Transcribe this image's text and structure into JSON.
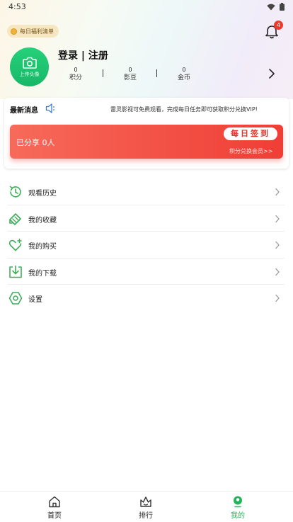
{
  "status_bar": {
    "time": "4:53"
  },
  "header": {
    "welfare_label": "每日福利清单",
    "notification_count": "4"
  },
  "profile": {
    "avatar_label": "上传头像",
    "login_label": "登录 | 注册",
    "stats": [
      {
        "value": "0",
        "label": "积分"
      },
      {
        "value": "0",
        "label": "影豆"
      },
      {
        "value": "0",
        "label": "金币"
      }
    ]
  },
  "news": {
    "title": "最新消息",
    "message": "雷灵影视可免费观看，完成每日任务即可获取积分兑换VIP!"
  },
  "share": {
    "shared_text": "已分享 0人",
    "signin_label": "每日签到",
    "exchange_label": "积分兑换会员>>"
  },
  "menu": {
    "items": [
      {
        "label": "观看历史",
        "icon": "history-icon"
      },
      {
        "label": "我的收藏",
        "icon": "collection-icon"
      },
      {
        "label": "我的购买",
        "icon": "purchase-heart-icon"
      },
      {
        "label": "我的下载",
        "icon": "download-icon"
      },
      {
        "label": "设置",
        "icon": "settings-icon"
      }
    ]
  },
  "tabbar": {
    "tabs": [
      {
        "label": "首页",
        "icon": "home-icon"
      },
      {
        "label": "排行",
        "icon": "ranking-crown-icon"
      },
      {
        "label": "我的",
        "icon": "profile-icon"
      }
    ],
    "active_index": 2
  },
  "colors": {
    "accent_green": "#22b35c",
    "share_red": "#ef3e36",
    "badge_red": "#f0382b"
  }
}
